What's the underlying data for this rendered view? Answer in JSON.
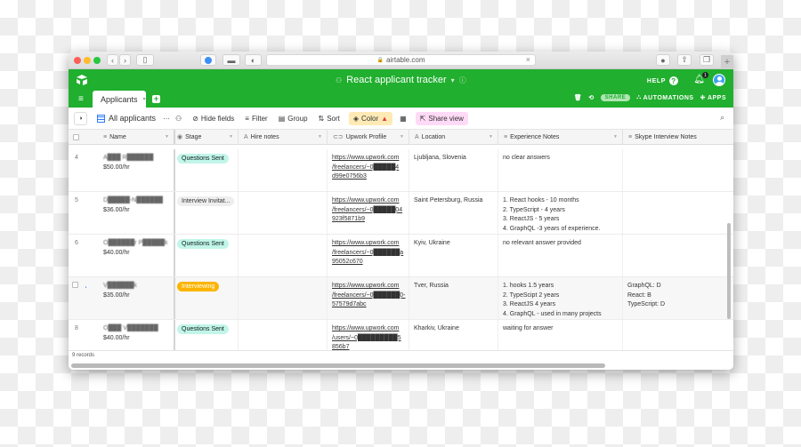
{
  "browser": {
    "url": "airtable.com",
    "close_url_icon": "×",
    "new_tab_icon": "+"
  },
  "app": {
    "base_title": "React applicant tracker",
    "base_caret": "▾",
    "info_icon": "ⓘ",
    "help_label": "HELP",
    "help_icon": "?",
    "notification_count": "1",
    "table_tab": "Applicants",
    "add_table_icon": "+",
    "share_label": "SHARE",
    "automations_label": "AUTOMATIONS",
    "apps_label": "APPS"
  },
  "toolbar": {
    "view_name": "All applicants",
    "more_icon": "···",
    "hide_fields": "Hide fields",
    "filter": "Filter",
    "group": "Group",
    "sort": "Sort",
    "color": "Color",
    "share_view": "Share view"
  },
  "columns": [
    {
      "label": "Name",
      "icon": "≡"
    },
    {
      "label": "Stage",
      "icon": "◉"
    },
    {
      "label": "Hire notes",
      "icon": "A"
    },
    {
      "label": "Upwork Profile",
      "icon": "⊂⊃"
    },
    {
      "label": "Location",
      "icon": "A"
    },
    {
      "label": "Experience Notes",
      "icon": "≡"
    },
    {
      "label": "Skype Interview Notes",
      "icon": "≡"
    }
  ],
  "rows": [
    {
      "num": "4",
      "name": "A███ R██████",
      "rate": "$50.00/hr",
      "stage": "Questions Sent",
      "stage_type": "qs",
      "hire_notes": "",
      "upwork": [
        "https://www.upwork.com",
        "/freelancers/~0█████4",
        "d99e0756b3"
      ],
      "location": "Ljubljana, Slovenia",
      "experience": [
        "no clear answers"
      ],
      "skype": []
    },
    {
      "num": "5",
      "name": "D█████-N██████",
      "rate": "$36.00/hr",
      "stage": "Interview Invitat...",
      "stage_type": "ii",
      "hire_notes": "",
      "upwork": [
        "https://www.upwork.com",
        "/freelancers/~0█████04",
        "923f5871b9"
      ],
      "location": "Saint Petersburg, Russia",
      "experience": [
        "1. React hooks - 10 months",
        "2. TypeScript - 4 years",
        "3. ReactJS - 5 years",
        "4. GraphQL -3  years of experience."
      ],
      "skype": []
    },
    {
      "num": "6",
      "name": "O██████r P█████k",
      "rate": "$40.00/hr",
      "stage": "Questions Sent",
      "stage_type": "qs",
      "hire_notes": "",
      "upwork": [
        "https://www.upwork.com",
        "/freelancers/~0██████a",
        "95052c670"
      ],
      "location": "Kyiv, Ukraine",
      "experience": [
        "no relevant answer provided"
      ],
      "skype": []
    },
    {
      "num": "",
      "name": "V██████k",
      "rate": "$35.00/hr",
      "stage": "Interviewing",
      "stage_type": "iv",
      "hire_notes": "",
      "upwork": [
        "https://www.upwork.com",
        "/freelancers/~0██████0-",
        "57579d7abc"
      ],
      "location": "Tver, Russia",
      "experience": [
        "1. hooks  1.5 years",
        "2. TypeScipt  2 years",
        "3. ReactJS 4 years",
        "4. GraphQL - used in many projects"
      ],
      "skype": [
        "GraphQL: D",
        "React: B",
        "TypeScript: D"
      ]
    },
    {
      "num": "8",
      "name": "O███ V███████",
      "rate": "$40.00/hr",
      "stage": "Questions Sent",
      "stage_type": "qs",
      "hire_notes": "",
      "upwork": [
        "https://www.upwork.com",
        "/users/~0█████████5",
        "856b7"
      ],
      "location": "Kharkiv, Ukraine",
      "experience": [
        "waiting for answer"
      ],
      "skype": []
    }
  ],
  "footer": {
    "record_count": "9 records"
  },
  "colors": {
    "brand_green": "#20af2e",
    "questions_sent": "#c2f5e9",
    "interviewing": "#fcb400",
    "color_button_bg": "#ffeab6",
    "share_view_bg": "#ffdaf6"
  }
}
